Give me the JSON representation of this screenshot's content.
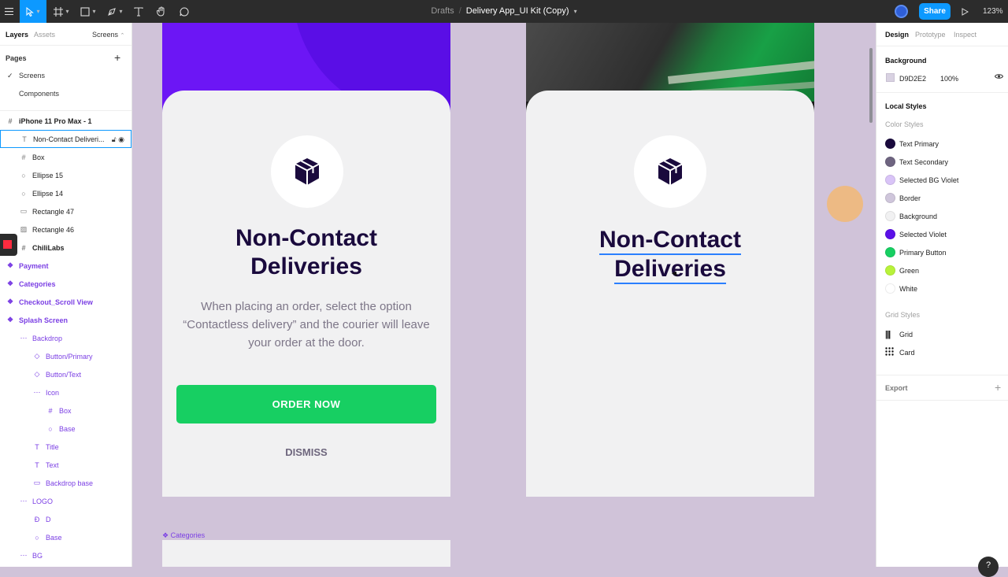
{
  "toolbar": {
    "breadcrumb_parent": "Drafts",
    "breadcrumb_separator": "/",
    "file_name": "Delivery App_UI Kit (Copy)",
    "share_label": "Share",
    "zoom": "123%"
  },
  "left_panel": {
    "tabs": {
      "layers": "Layers",
      "assets": "Assets",
      "pages_dropdown": "Screens"
    },
    "pages_heading": "Pages",
    "pages": [
      "Screens",
      "Components"
    ],
    "layers": [
      {
        "label": "iPhone 11 Pro Max - 1",
        "icon": "frame-icon"
      },
      {
        "label": "Non-Contact Deliveri...",
        "icon": "text-icon"
      },
      {
        "label": "Box",
        "icon": "frame-icon"
      },
      {
        "label": "Ellipse 15",
        "icon": "ellipse-icon"
      },
      {
        "label": "Ellipse 14",
        "icon": "ellipse-icon"
      },
      {
        "label": "Rectangle 47",
        "icon": "rectangle-icon"
      },
      {
        "label": "Rectangle 46",
        "icon": "image-icon"
      },
      {
        "label": "ChiliLabs",
        "icon": "frame-icon"
      },
      {
        "label": "Payment",
        "icon": "component-icon"
      },
      {
        "label": "Categories",
        "icon": "component-icon"
      },
      {
        "label": "Checkout_Scroll View",
        "icon": "component-icon"
      },
      {
        "label": "Splash Screen",
        "icon": "component-icon"
      },
      {
        "label": "Backdrop",
        "icon": "group-icon"
      },
      {
        "label": "Button/Primary",
        "icon": "instance-icon"
      },
      {
        "label": "Button/Text",
        "icon": "instance-icon"
      },
      {
        "label": "Icon",
        "icon": "group-icon"
      },
      {
        "label": "Box",
        "icon": "frame-icon"
      },
      {
        "label": "Base",
        "icon": "ellipse-icon"
      },
      {
        "label": "Title",
        "icon": "text-icon"
      },
      {
        "label": "Text",
        "icon": "text-icon"
      },
      {
        "label": "Backdrop base",
        "icon": "rectangle-icon"
      },
      {
        "label": "LOGO",
        "icon": "group-icon"
      },
      {
        "label": "D",
        "icon": "vector-icon"
      },
      {
        "label": "Base",
        "icon": "ellipse-icon"
      },
      {
        "label": "BG",
        "icon": "group-icon"
      }
    ]
  },
  "canvas": {
    "screen_left": {
      "heading_line1": "Non-Contact",
      "heading_line2": "Deliveries",
      "body": "When placing an order, select the option “Contactless delivery” and the courier will leave your order at the door.",
      "primary_button": "ORDER NOW",
      "secondary_button": "DISMISS"
    },
    "screen_right": {
      "heading_line1": "Non-Contact",
      "heading_line2": "Deliveries"
    },
    "categories_frame_label": "Categories"
  },
  "right_panel": {
    "tabs": {
      "design": "Design",
      "prototype": "Prototype",
      "inspect": "Inspect"
    },
    "background_heading": "Background",
    "background_hex": "D9D2E2",
    "background_opacity": "100%",
    "local_styles_heading": "Local Styles",
    "color_styles_heading": "Color Styles",
    "color_styles": [
      {
        "name": "Text Primary",
        "color": "#1a0a3d"
      },
      {
        "name": "Text Secondary",
        "color": "#6e6480"
      },
      {
        "name": "Selected BG Violet",
        "color": "#d9c4f7"
      },
      {
        "name": "Border",
        "color": "#cfc6db"
      },
      {
        "name": "Background",
        "color": "#f1f1f2"
      },
      {
        "name": "Selected Violet",
        "color": "#5b10e8"
      },
      {
        "name": "Primary Button",
        "color": "#17cf62"
      },
      {
        "name": "Green",
        "color": "#b8f23a"
      },
      {
        "name": "White",
        "color": "#ffffff"
      }
    ],
    "grid_styles_heading": "Grid Styles",
    "grid_styles": [
      {
        "name": "Grid",
        "icon": "columns-grid-icon"
      },
      {
        "name": "Card",
        "icon": "dots-grid-icon"
      }
    ],
    "export_heading": "Export"
  },
  "help_label": "?"
}
